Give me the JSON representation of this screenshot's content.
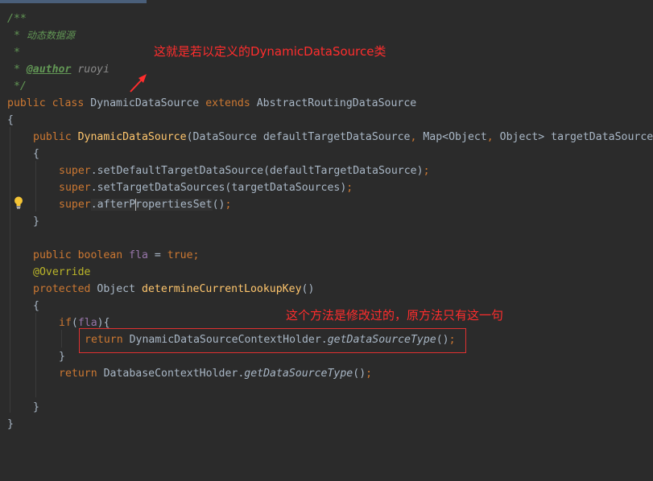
{
  "code": {
    "l1": "/**",
    "l2_prefix": " * ",
    "l2_text": "动态数据源",
    "l3": " *",
    "l4_prefix": " * ",
    "l4_tag": "@author",
    "l4_value": "ruoyi",
    "l5": " */",
    "l6_public": "public",
    "l6_class": "class",
    "l6_name": "DynamicDataSource",
    "l6_extends": "extends",
    "l6_parent": "AbstractRoutingDataSource",
    "l7": "{",
    "l8_public": "public",
    "l8_ctor": "DynamicDataSource",
    "l8_params_a": "(DataSource defaultTargetDataSource",
    "l8_comma1": ",",
    "l8_params_b": " Map<Object",
    "l8_comma2": ",",
    "l8_params_c": " Object> targetDataSource",
    "l9": "{",
    "l10_super": "super",
    "l10_rest": ".setDefaultTargetDataSource(defaultTargetDataSource)",
    "l10_semi": ";",
    "l11_super": "super",
    "l11_rest": ".setTargetDataSources(targetDataSources)",
    "l11_semi": ";",
    "l12_super": "super",
    "l12_a": ".afterP",
    "l12_b": "ropertiesSet",
    "l12_c": "()",
    "l12_semi": ";",
    "l13": "}",
    "l15_public": "public",
    "l15_boolean": "boolean",
    "l15_field": "fla",
    "l15_eq": " = ",
    "l15_true": "true",
    "l15_semi": ";",
    "l16_ann": "@Override",
    "l17_protected": "protected",
    "l17_type": "Object",
    "l17_fn": "determineCurrentLookupKey",
    "l17_parens": "()",
    "l18": "{",
    "l19_if": "if",
    "l19_open": "(",
    "l19_field": "fla",
    "l19_close": "){",
    "l20_return": "return",
    "l20_cls": "DynamicDataSourceContextHolder.",
    "l20_fn": "getDataSourceType",
    "l20_end": "()",
    "l20_semi": ";",
    "l21": "}",
    "l22_return": "return",
    "l22_cls": "DatabaseContextHolder.",
    "l22_fn": "getDataSourceType",
    "l22_end": "()",
    "l22_semi": ";",
    "l24": "}",
    "l25": "}"
  },
  "annotations": {
    "note_class": "这就是若以定义的DynamicDataSource类",
    "note_method": "这个方法是修改过的，原方法只有这一句",
    "color": "#ff2d2d"
  },
  "icons": {
    "bulb": "lightbulb-icon",
    "arrow": "arrow-icon"
  }
}
